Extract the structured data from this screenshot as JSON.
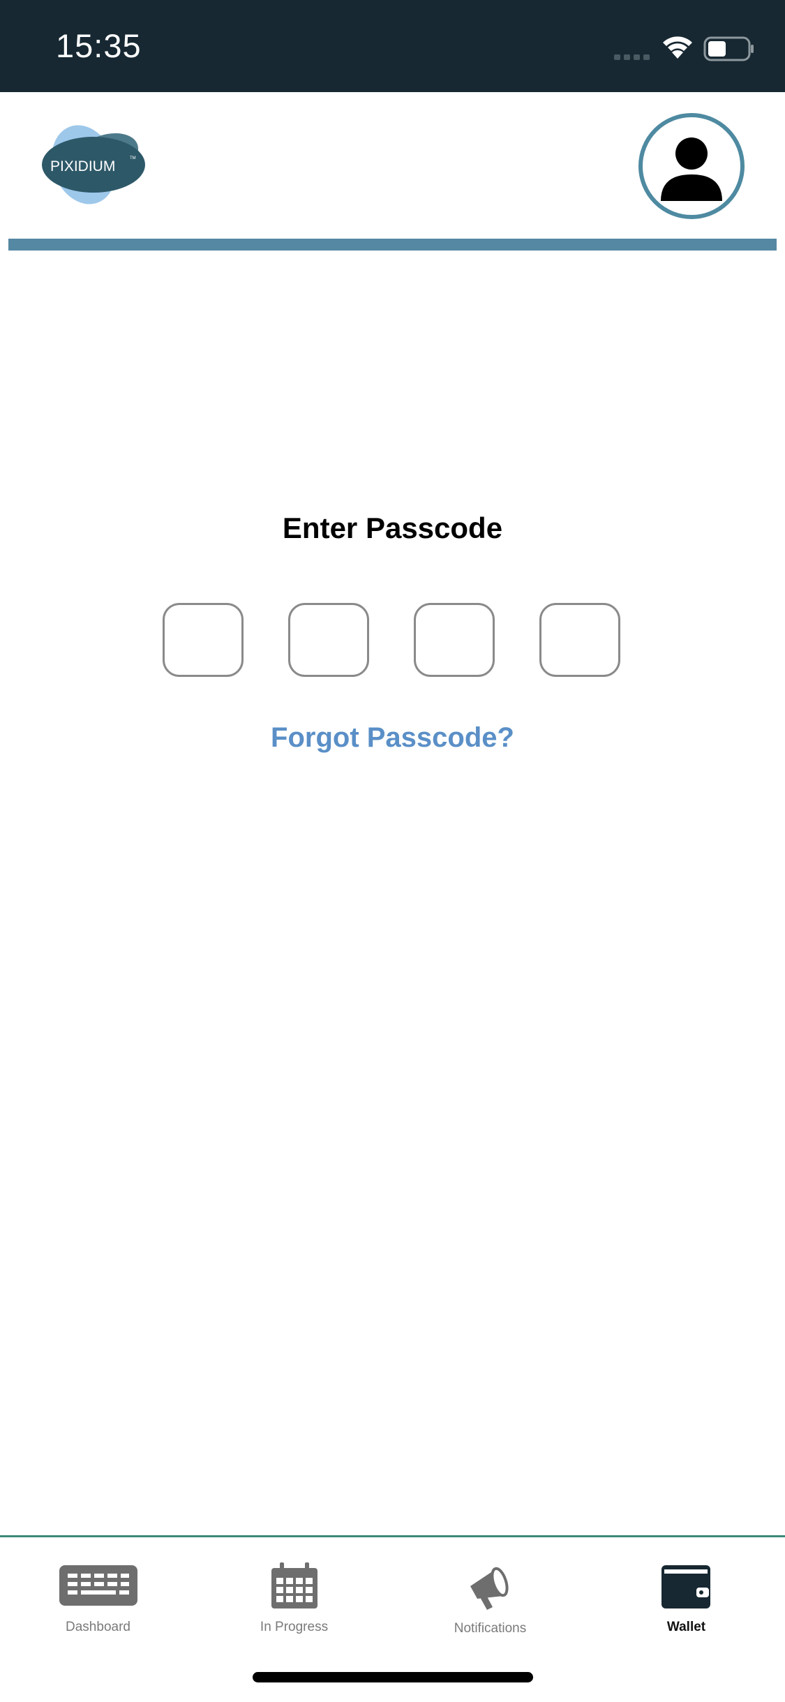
{
  "status_bar": {
    "time": "15:35",
    "icons": [
      "cellular-signal-icon",
      "wifi-icon",
      "battery-icon"
    ],
    "background": "#172832"
  },
  "header": {
    "logo_text": "PIXIDIUM",
    "logo_trademark": "TM",
    "avatar_icon": "user-icon",
    "accent": "#5588a2"
  },
  "passcode": {
    "title": "Enter Passcode",
    "digits": [
      "",
      "",
      "",
      ""
    ],
    "forgot_label": "Forgot Passcode?",
    "link_color": "#5a8fc7"
  },
  "tab_bar": {
    "tabs": [
      {
        "label": "Dashboard",
        "icon": "keyboard-icon",
        "active": false
      },
      {
        "label": "In Progress",
        "icon": "calendar-icon",
        "active": false
      },
      {
        "label": "Notifications",
        "icon": "megaphone-icon",
        "active": false
      },
      {
        "label": "Wallet",
        "icon": "wallet-icon",
        "active": true
      }
    ],
    "border_color": "#3d8a78"
  }
}
